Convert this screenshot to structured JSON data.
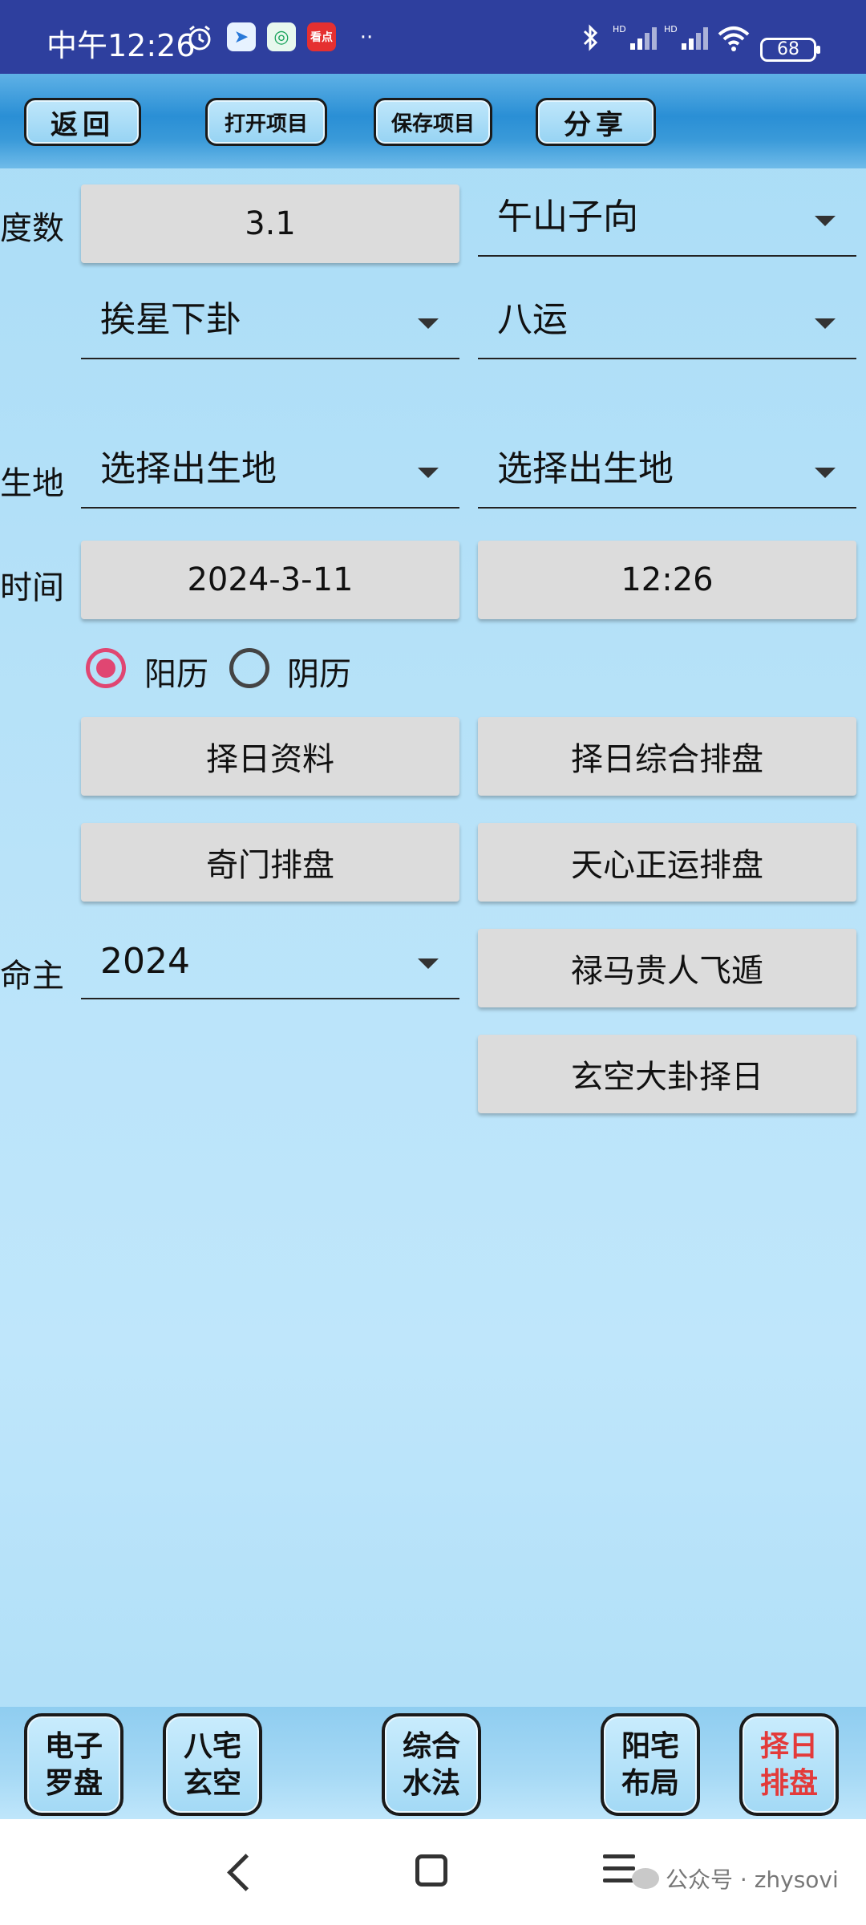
{
  "status_bar": {
    "time": "中午12:26",
    "app_icon_label": "看点",
    "battery": "68"
  },
  "toolbar": {
    "back": "返回",
    "open_project": "打开项目",
    "save_project": "保存项目",
    "share": "分享"
  },
  "form": {
    "degree_label": "度数",
    "degree_value": "3.1",
    "mountain_direction": "午山子向",
    "star_mode": "挨星下卦",
    "period": "八运",
    "birthplace_label": "生地",
    "birthplace_1": "选择出生地",
    "birthplace_2": "选择出生地",
    "time_label": "时间",
    "date_value": "2024-3-11",
    "time_value": "12:26",
    "calendar_solar": "阳历",
    "calendar_lunar": "阴历",
    "calendar_selected": "阳历",
    "owner_label": "命主",
    "owner_year": "2024"
  },
  "actions": {
    "date_info": "择日资料",
    "date_chart": "择日综合排盘",
    "qimen_chart": "奇门排盘",
    "tianxin_chart": "天心正运排盘",
    "lu_ma": "禄马贵人飞遁",
    "xuankong_date": "玄空大卦择日"
  },
  "modules": [
    {
      "line1": "电子",
      "line2": "罗盘"
    },
    {
      "line1": "八宅",
      "line2": "玄空"
    },
    {
      "line1": "综合",
      "line2": "水法"
    },
    {
      "line1": "阳宅",
      "line2": "布局"
    },
    {
      "line1": "择日",
      "line2": "排盘"
    }
  ],
  "watermark": "公众号 · zhysovi",
  "colors": {
    "status_bar": "#2e3f9e",
    "radio_accent": "#e04672",
    "active_module": "#e33a3a"
  }
}
